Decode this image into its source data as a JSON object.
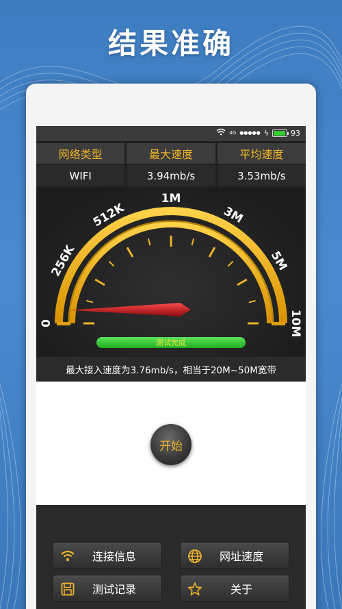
{
  "headline": "结果准确",
  "status_bar": {
    "signal_label": "4G",
    "battery": "93",
    "battery_level": 0.93
  },
  "stats": {
    "headers": [
      "网络类型",
      "最大速度",
      "平均速度"
    ],
    "values": [
      "WIFI",
      "3.94mb/s",
      "3.53mb/s"
    ]
  },
  "gauge": {
    "scale_labels": [
      "0",
      "256K",
      "512K",
      "1M",
      "3M",
      "5M",
      "10M"
    ],
    "needle_value_fraction": 0.015,
    "progress_text": "测试完成",
    "colors": {
      "arc": "#f0b429",
      "needle": "#c0141b",
      "progress": "#2fc02f"
    }
  },
  "result_text": "最大接入速度为3.76mb/s，相当于20M~50M宽带",
  "start_button": "开始",
  "menu": {
    "items": [
      {
        "label": "连接信息",
        "icon": "wifi-icon"
      },
      {
        "label": "网址速度",
        "icon": "globe-icon"
      },
      {
        "label": "测试记录",
        "icon": "save-icon"
      },
      {
        "label": "关于",
        "icon": "star-icon"
      }
    ]
  }
}
